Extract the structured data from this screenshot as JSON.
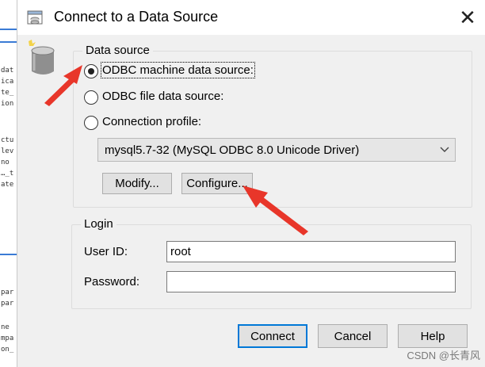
{
  "window": {
    "title": "Connect to a Data Source",
    "close_glyph": "✕"
  },
  "background_window": {
    "code_lines": [
      "dat",
      "ica",
      "te_",
      "ion",
      "ctu",
      "lev",
      "no",
      "…_t",
      "ate",
      "par",
      "par",
      "ne",
      "mpa",
      "on_"
    ]
  },
  "data_source": {
    "legend": "Data source",
    "odbc_machine": {
      "label": "ODBC machine data source:",
      "checked": true
    },
    "odbc_file": {
      "label": "ODBC file data source:",
      "checked": false
    },
    "connection_profile": {
      "label": "Connection profile:",
      "checked": false
    },
    "driver_select": {
      "value": "mysql5.7-32 (MySQL ODBC 8.0 Unicode Driver)"
    },
    "modify_label": "Modify...",
    "configure_label": "Configure..."
  },
  "login": {
    "legend": "Login",
    "user_id_label": "User ID:",
    "user_id_value": "root",
    "password_label": "Password:",
    "password_value": ""
  },
  "buttons": {
    "connect": "Connect",
    "cancel": "Cancel",
    "help": "Help"
  },
  "watermark": "CSDN @长青风",
  "colors": {
    "arrow": "#e8362a",
    "accent": "#0078d7"
  },
  "icons": {
    "title": "database-icon",
    "group": "database-cylinder-icon",
    "close": "close-icon",
    "dropdown": "chevron-down-icon"
  }
}
